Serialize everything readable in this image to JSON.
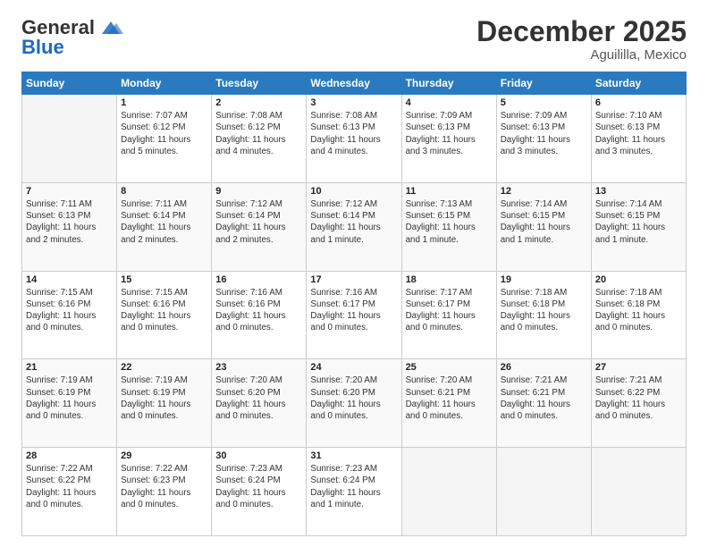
{
  "header": {
    "logo_general": "General",
    "logo_blue": "Blue",
    "title": "December 2025",
    "subtitle": "Aguililla, Mexico"
  },
  "calendar": {
    "days_of_week": [
      "Sunday",
      "Monday",
      "Tuesday",
      "Wednesday",
      "Thursday",
      "Friday",
      "Saturday"
    ],
    "weeks": [
      [
        {
          "num": "",
          "info": ""
        },
        {
          "num": "1",
          "info": "Sunrise: 7:07 AM\nSunset: 6:12 PM\nDaylight: 11 hours\nand 5 minutes."
        },
        {
          "num": "2",
          "info": "Sunrise: 7:08 AM\nSunset: 6:12 PM\nDaylight: 11 hours\nand 4 minutes."
        },
        {
          "num": "3",
          "info": "Sunrise: 7:08 AM\nSunset: 6:13 PM\nDaylight: 11 hours\nand 4 minutes."
        },
        {
          "num": "4",
          "info": "Sunrise: 7:09 AM\nSunset: 6:13 PM\nDaylight: 11 hours\nand 3 minutes."
        },
        {
          "num": "5",
          "info": "Sunrise: 7:09 AM\nSunset: 6:13 PM\nDaylight: 11 hours\nand 3 minutes."
        },
        {
          "num": "6",
          "info": "Sunrise: 7:10 AM\nSunset: 6:13 PM\nDaylight: 11 hours\nand 3 minutes."
        }
      ],
      [
        {
          "num": "7",
          "info": "Sunrise: 7:11 AM\nSunset: 6:13 PM\nDaylight: 11 hours\nand 2 minutes."
        },
        {
          "num": "8",
          "info": "Sunrise: 7:11 AM\nSunset: 6:14 PM\nDaylight: 11 hours\nand 2 minutes."
        },
        {
          "num": "9",
          "info": "Sunrise: 7:12 AM\nSunset: 6:14 PM\nDaylight: 11 hours\nand 2 minutes."
        },
        {
          "num": "10",
          "info": "Sunrise: 7:12 AM\nSunset: 6:14 PM\nDaylight: 11 hours\nand 1 minute."
        },
        {
          "num": "11",
          "info": "Sunrise: 7:13 AM\nSunset: 6:15 PM\nDaylight: 11 hours\nand 1 minute."
        },
        {
          "num": "12",
          "info": "Sunrise: 7:14 AM\nSunset: 6:15 PM\nDaylight: 11 hours\nand 1 minute."
        },
        {
          "num": "13",
          "info": "Sunrise: 7:14 AM\nSunset: 6:15 PM\nDaylight: 11 hours\nand 1 minute."
        }
      ],
      [
        {
          "num": "14",
          "info": "Sunrise: 7:15 AM\nSunset: 6:16 PM\nDaylight: 11 hours\nand 0 minutes."
        },
        {
          "num": "15",
          "info": "Sunrise: 7:15 AM\nSunset: 6:16 PM\nDaylight: 11 hours\nand 0 minutes."
        },
        {
          "num": "16",
          "info": "Sunrise: 7:16 AM\nSunset: 6:16 PM\nDaylight: 11 hours\nand 0 minutes."
        },
        {
          "num": "17",
          "info": "Sunrise: 7:16 AM\nSunset: 6:17 PM\nDaylight: 11 hours\nand 0 minutes."
        },
        {
          "num": "18",
          "info": "Sunrise: 7:17 AM\nSunset: 6:17 PM\nDaylight: 11 hours\nand 0 minutes."
        },
        {
          "num": "19",
          "info": "Sunrise: 7:18 AM\nSunset: 6:18 PM\nDaylight: 11 hours\nand 0 minutes."
        },
        {
          "num": "20",
          "info": "Sunrise: 7:18 AM\nSunset: 6:18 PM\nDaylight: 11 hours\nand 0 minutes."
        }
      ],
      [
        {
          "num": "21",
          "info": "Sunrise: 7:19 AM\nSunset: 6:19 PM\nDaylight: 11 hours\nand 0 minutes."
        },
        {
          "num": "22",
          "info": "Sunrise: 7:19 AM\nSunset: 6:19 PM\nDaylight: 11 hours\nand 0 minutes."
        },
        {
          "num": "23",
          "info": "Sunrise: 7:20 AM\nSunset: 6:20 PM\nDaylight: 11 hours\nand 0 minutes."
        },
        {
          "num": "24",
          "info": "Sunrise: 7:20 AM\nSunset: 6:20 PM\nDaylight: 11 hours\nand 0 minutes."
        },
        {
          "num": "25",
          "info": "Sunrise: 7:20 AM\nSunset: 6:21 PM\nDaylight: 11 hours\nand 0 minutes."
        },
        {
          "num": "26",
          "info": "Sunrise: 7:21 AM\nSunset: 6:21 PM\nDaylight: 11 hours\nand 0 minutes."
        },
        {
          "num": "27",
          "info": "Sunrise: 7:21 AM\nSunset: 6:22 PM\nDaylight: 11 hours\nand 0 minutes."
        }
      ],
      [
        {
          "num": "28",
          "info": "Sunrise: 7:22 AM\nSunset: 6:22 PM\nDaylight: 11 hours\nand 0 minutes."
        },
        {
          "num": "29",
          "info": "Sunrise: 7:22 AM\nSunset: 6:23 PM\nDaylight: 11 hours\nand 0 minutes."
        },
        {
          "num": "30",
          "info": "Sunrise: 7:23 AM\nSunset: 6:24 PM\nDaylight: 11 hours\nand 0 minutes."
        },
        {
          "num": "31",
          "info": "Sunrise: 7:23 AM\nSunset: 6:24 PM\nDaylight: 11 hours\nand 1 minute."
        },
        {
          "num": "",
          "info": ""
        },
        {
          "num": "",
          "info": ""
        },
        {
          "num": "",
          "info": ""
        }
      ]
    ]
  }
}
